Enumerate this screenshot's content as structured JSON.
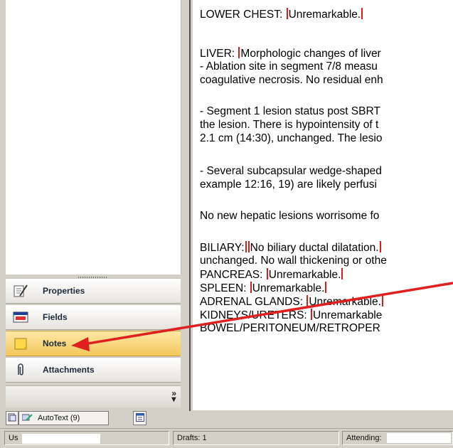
{
  "sidebar": {
    "items": [
      {
        "label": "Properties",
        "icon": "properties-icon"
      },
      {
        "label": "Fields",
        "icon": "fields-icon"
      },
      {
        "label": "Notes",
        "icon": "notes-icon"
      },
      {
        "label": "Attachments",
        "icon": "attachments-icon"
      }
    ],
    "more_icon": "chevron-more-icon"
  },
  "tabs": {
    "autotext_label": "AutoText (9)"
  },
  "document": {
    "lines": [
      [
        "LOWER CHEST: ",
        "|",
        "Unremarkable.",
        "|"
      ],
      [
        "LIVER: ",
        "|",
        "Morphologic changes of liver"
      ],
      [
        "- Ablation site in segment 7/8 measu"
      ],
      [
        "coagulative necrosis. No residual enh"
      ],
      [
        "- Segment 1 lesion status post SBRT"
      ],
      [
        "the lesion. There is hypointensity of t"
      ],
      [
        "2.1 cm (14:30), unchanged. The lesio"
      ],
      [
        "- Several subcapsular wedge-shaped"
      ],
      [
        "example 12:16, 19) are likely perfusi"
      ],
      [
        "No new hepatic lesions worrisome fo"
      ],
      [
        "BILIARY:",
        "|",
        "|",
        "No biliary ductal dilatation.",
        "|"
      ],
      [
        "unchanged. No wall thickening or othe"
      ],
      [
        "PANCREAS: ",
        "|",
        "Unremarkable.",
        "|"
      ],
      [
        "SPLEEN: ",
        "|",
        "Unremarkable.",
        "|"
      ],
      [
        "ADRENAL GLANDS: ",
        "|",
        "Unremarkable.",
        "|"
      ],
      [
        "KIDNEYS/URETERS: ",
        "|",
        "Unremarkable"
      ],
      [
        "BOWEL/PERITONEUM/RETROPER"
      ]
    ]
  },
  "status": {
    "user_label": "Us",
    "drafts_label": "Drafts: 1",
    "attending_label": "Attending:"
  },
  "colors": {
    "marker": "#d3201b",
    "arrow": "#e02020",
    "notes_highlight": "#f2c75a"
  }
}
